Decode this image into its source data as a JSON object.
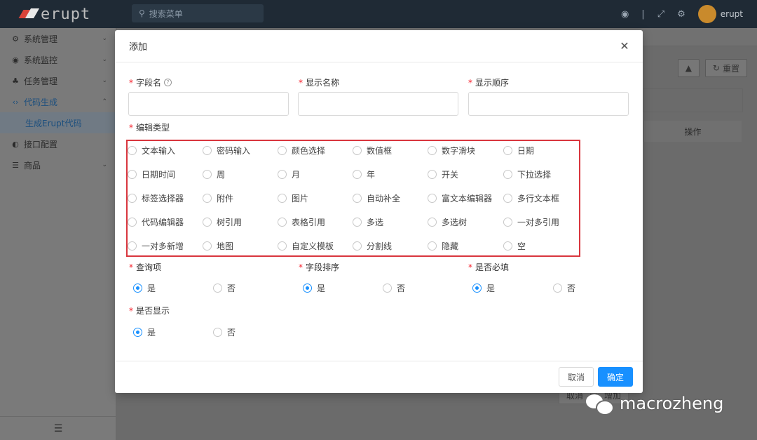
{
  "app": {
    "logo_text": "erupt",
    "search_placeholder": "搜索菜单",
    "user_name": "erupt"
  },
  "sidebar": {
    "items": [
      {
        "label": "系统管理",
        "icon": "gears-icon"
      },
      {
        "label": "系统监控",
        "icon": "monitor-icon"
      },
      {
        "label": "任务管理",
        "icon": "task-icon"
      },
      {
        "label": "代码生成",
        "icon": "code-icon"
      },
      {
        "label": "接口配置",
        "icon": "api-icon"
      },
      {
        "label": "商品",
        "icon": "list-icon"
      }
    ],
    "active_sub": "生成Erupt代码"
  },
  "background": {
    "reset_label": "重置",
    "column_header": "操作",
    "cancel_label": "取消",
    "add_label": "增加"
  },
  "modal": {
    "title": "添加",
    "fields": {
      "field_name": "字段名",
      "display_name": "显示名称",
      "display_order": "显示顺序",
      "edit_type": "编辑类型",
      "query_item": "查询项",
      "field_sort": "字段排序",
      "required": "是否必填",
      "show": "是否显示"
    },
    "edit_types": [
      "文本输入",
      "密码输入",
      "颜色选择",
      "数值框",
      "数字滑块",
      "日期",
      "日期时间",
      "周",
      "月",
      "年",
      "开关",
      "下拉选择",
      "标签选择器",
      "附件",
      "图片",
      "自动补全",
      "富文本编辑器",
      "多行文本框",
      "代码编辑器",
      "树引用",
      "表格引用",
      "多选",
      "多选树",
      "一对多引用",
      "一对多新增",
      "地图",
      "自定义模板",
      "分割线",
      "隐藏",
      "空"
    ],
    "yes": "是",
    "no": "否",
    "cancel": "取消",
    "ok": "确定"
  },
  "watermark": "macrozheng",
  "colors": {
    "primary": "#1890ff",
    "required": "#f5222d",
    "highlight_box": "#d9363e",
    "topbar": "#1f2a35"
  }
}
